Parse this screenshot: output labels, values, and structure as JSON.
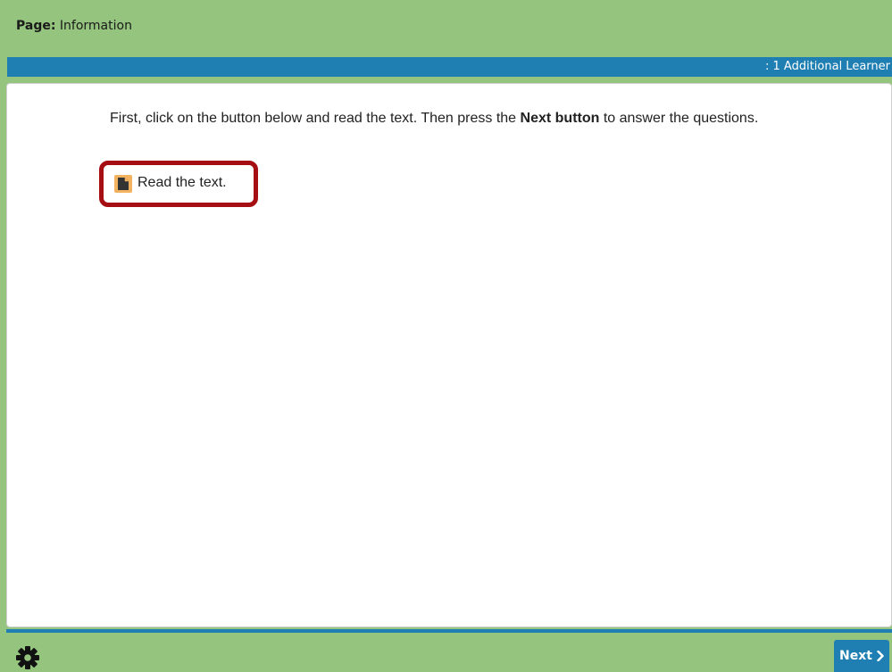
{
  "header": {
    "page_prefix": "Page:",
    "page_name": "Information",
    "learner_info": ": 1 Additional Learner"
  },
  "main": {
    "instruction_part1": "First, click on the button below and read the text. Then press the ",
    "instruction_bold": "Next button",
    "instruction_part2": " to answer the questions.",
    "read_link_label": "Read the text.",
    "read_link_icon": "document-icon"
  },
  "footer": {
    "settings_icon": "gear-icon",
    "next_label": "Next",
    "next_icon": "chevron-right-icon"
  },
  "colors": {
    "header_green": "#94c47d",
    "bar_blue": "#1f7fb2",
    "highlight_red": "#a50f14",
    "icon_orange": "#f3b25f"
  }
}
